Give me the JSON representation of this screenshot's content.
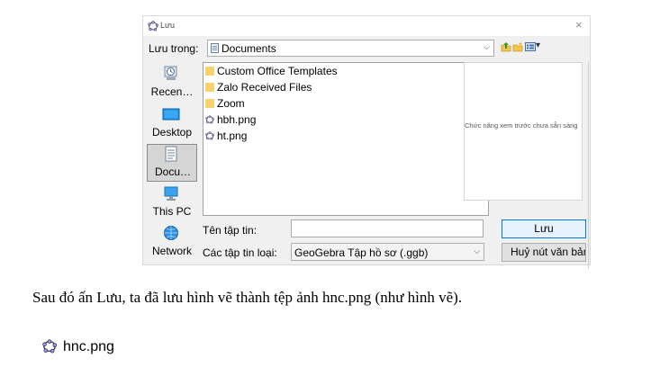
{
  "dialog": {
    "title": "Lưu",
    "close_glyph": "×",
    "look_in_label": "Lưu trong:",
    "look_in_value": "Documents",
    "dropdown_glyph": "⌵",
    "view_menu_glyph": "▾",
    "places": [
      {
        "label": "Recen…",
        "icon": "recent-places-icon"
      },
      {
        "label": "Desktop",
        "icon": "desktop-icon"
      },
      {
        "label": "Docu…",
        "icon": "documents-icon"
      },
      {
        "label": "This PC",
        "icon": "computer-icon"
      },
      {
        "label": "Network",
        "icon": "network-icon"
      }
    ],
    "files": [
      {
        "name": "Custom Office Templates",
        "type": "folder"
      },
      {
        "name": "Zalo Received Files",
        "type": "folder"
      },
      {
        "name": "Zoom",
        "type": "folder"
      },
      {
        "name": "hbh.png",
        "type": "geogebra"
      },
      {
        "name": "ht.png",
        "type": "geogebra"
      }
    ],
    "preview_text": "Chức năng xem trước chưa sẵn sàng",
    "file_name_label": "Tên tập tin:",
    "file_name_value": "",
    "file_type_label": "Các tập tin loại:",
    "file_type_value": "GeoGebra Tập hồ sơ (.ggb)",
    "save_label": "Lưu",
    "cancel_label": "Huỷ nút văn bản"
  },
  "caption": "Sau đó ấn Lưu, ta đã lưu hình vẽ thành tệp ảnh hnc.png (như hình vẽ).",
  "result_file": {
    "name": "hnc.png",
    "icon": "geogebra-file-icon"
  },
  "colors": {
    "accent": "#0078d7",
    "folder": "#f8d26a",
    "dialog_bg": "#f0f0f0"
  }
}
